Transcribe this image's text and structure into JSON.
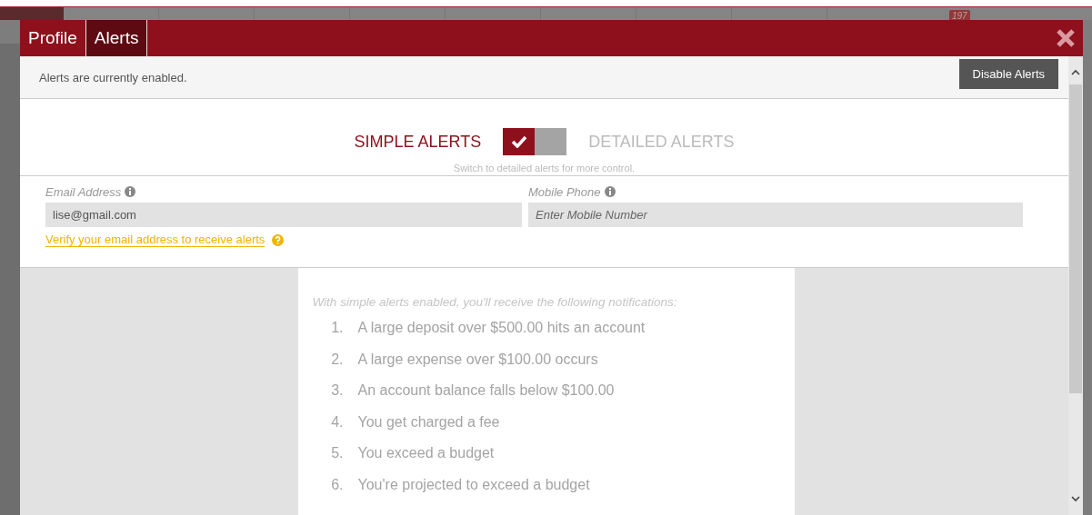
{
  "background": {
    "badge": "197"
  },
  "modal": {
    "tabs": [
      {
        "label": "Profile",
        "selected": false
      },
      {
        "label": "Alerts",
        "selected": true
      }
    ],
    "status": {
      "text": "Alerts are currently enabled.",
      "button": "Disable Alerts"
    },
    "mode_switch": {
      "left_label": "SIMPLE ALERTS",
      "right_label": "DETAILED ALERTS",
      "checked": true,
      "hint": "Switch to detailed alerts for more control."
    },
    "fields": [
      {
        "label": "Email Address",
        "value": "lise@gmail.com"
      },
      {
        "label": "Mobile Phone",
        "placeholder": "Enter Mobile Number"
      }
    ],
    "verify_link": "Verify your email address to receive alerts",
    "notifications": {
      "intro": "With simple alerts enabled, you'll receive the following notifications:",
      "items": [
        {
          "number": "1.",
          "text": "A large deposit over $500.00 hits an account"
        },
        {
          "number": "2.",
          "text": "A large expense over $100.00 occurs"
        },
        {
          "number": "3.",
          "text": "An account balance falls below $100.00"
        },
        {
          "number": "4.",
          "text": "You get charged a fee"
        },
        {
          "number": "5.",
          "text": "You exceed a budget"
        },
        {
          "number": "6.",
          "text": "You're projected to exceed a budget"
        }
      ]
    }
  }
}
